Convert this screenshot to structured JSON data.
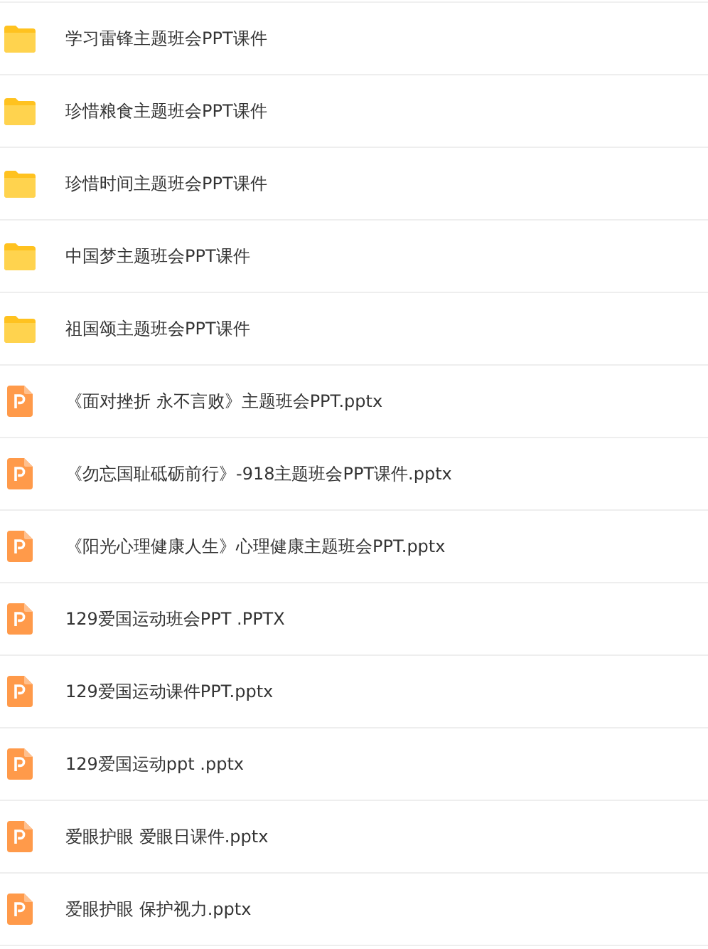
{
  "files": [
    {
      "kind": "folder",
      "name": "学习雷锋主题班会PPT课件"
    },
    {
      "kind": "folder",
      "name": "珍惜粮食主题班会PPT课件"
    },
    {
      "kind": "folder",
      "name": "珍惜时间主题班会PPT课件"
    },
    {
      "kind": "folder",
      "name": "中国梦主题班会PPT课件"
    },
    {
      "kind": "folder",
      "name": "祖国颂主题班会PPT课件"
    },
    {
      "kind": "pptx",
      "name": "《面对挫折 永不言败》主题班会PPT.pptx"
    },
    {
      "kind": "pptx",
      "name": "《勿忘国耻砥砺前行》-918主题班会PPT课件.pptx"
    },
    {
      "kind": "pptx",
      "name": "《阳光心理健康人生》心理健康主题班会PPT.pptx"
    },
    {
      "kind": "pptx",
      "name": "129爱国运动班会PPT .PPTX"
    },
    {
      "kind": "pptx",
      "name": "129爱国运动课件PPT.pptx"
    },
    {
      "kind": "pptx",
      "name": "129爱国运动ppt .pptx"
    },
    {
      "kind": "pptx",
      "name": "爱眼护眼 爱眼日课件.pptx"
    },
    {
      "kind": "pptx",
      "name": "爱眼护眼 保护视力.pptx"
    }
  ]
}
